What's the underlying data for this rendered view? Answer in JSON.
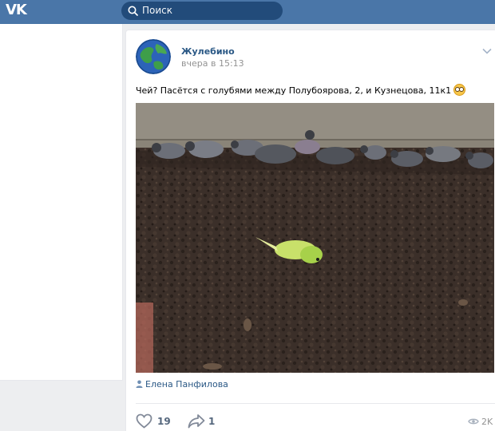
{
  "topbar": {
    "logo_text": "VK",
    "search": {
      "placeholder": "Поиск"
    }
  },
  "post": {
    "author": "Жулебино",
    "time": "вчера в 15:13",
    "text": "Чей? Пасётся с голубями между Полубоярова, 2, и Кузнецова, 11к1",
    "signer": "Елена Панфилова",
    "likes": "19",
    "shares": "1",
    "views": "2K"
  },
  "icons": [
    "vk-logo",
    "search-icon",
    "chevron-down-icon",
    "flushed-emoji-icon",
    "user-icon",
    "heart-icon",
    "share-arrow-icon",
    "eye-icon"
  ],
  "colors": {
    "header": "#4a76a8",
    "search_bg": "#224b7a",
    "link": "#2a5885",
    "secondary_text": "#939393",
    "action_text": "#55677d",
    "page_bg": "#edeef0"
  }
}
